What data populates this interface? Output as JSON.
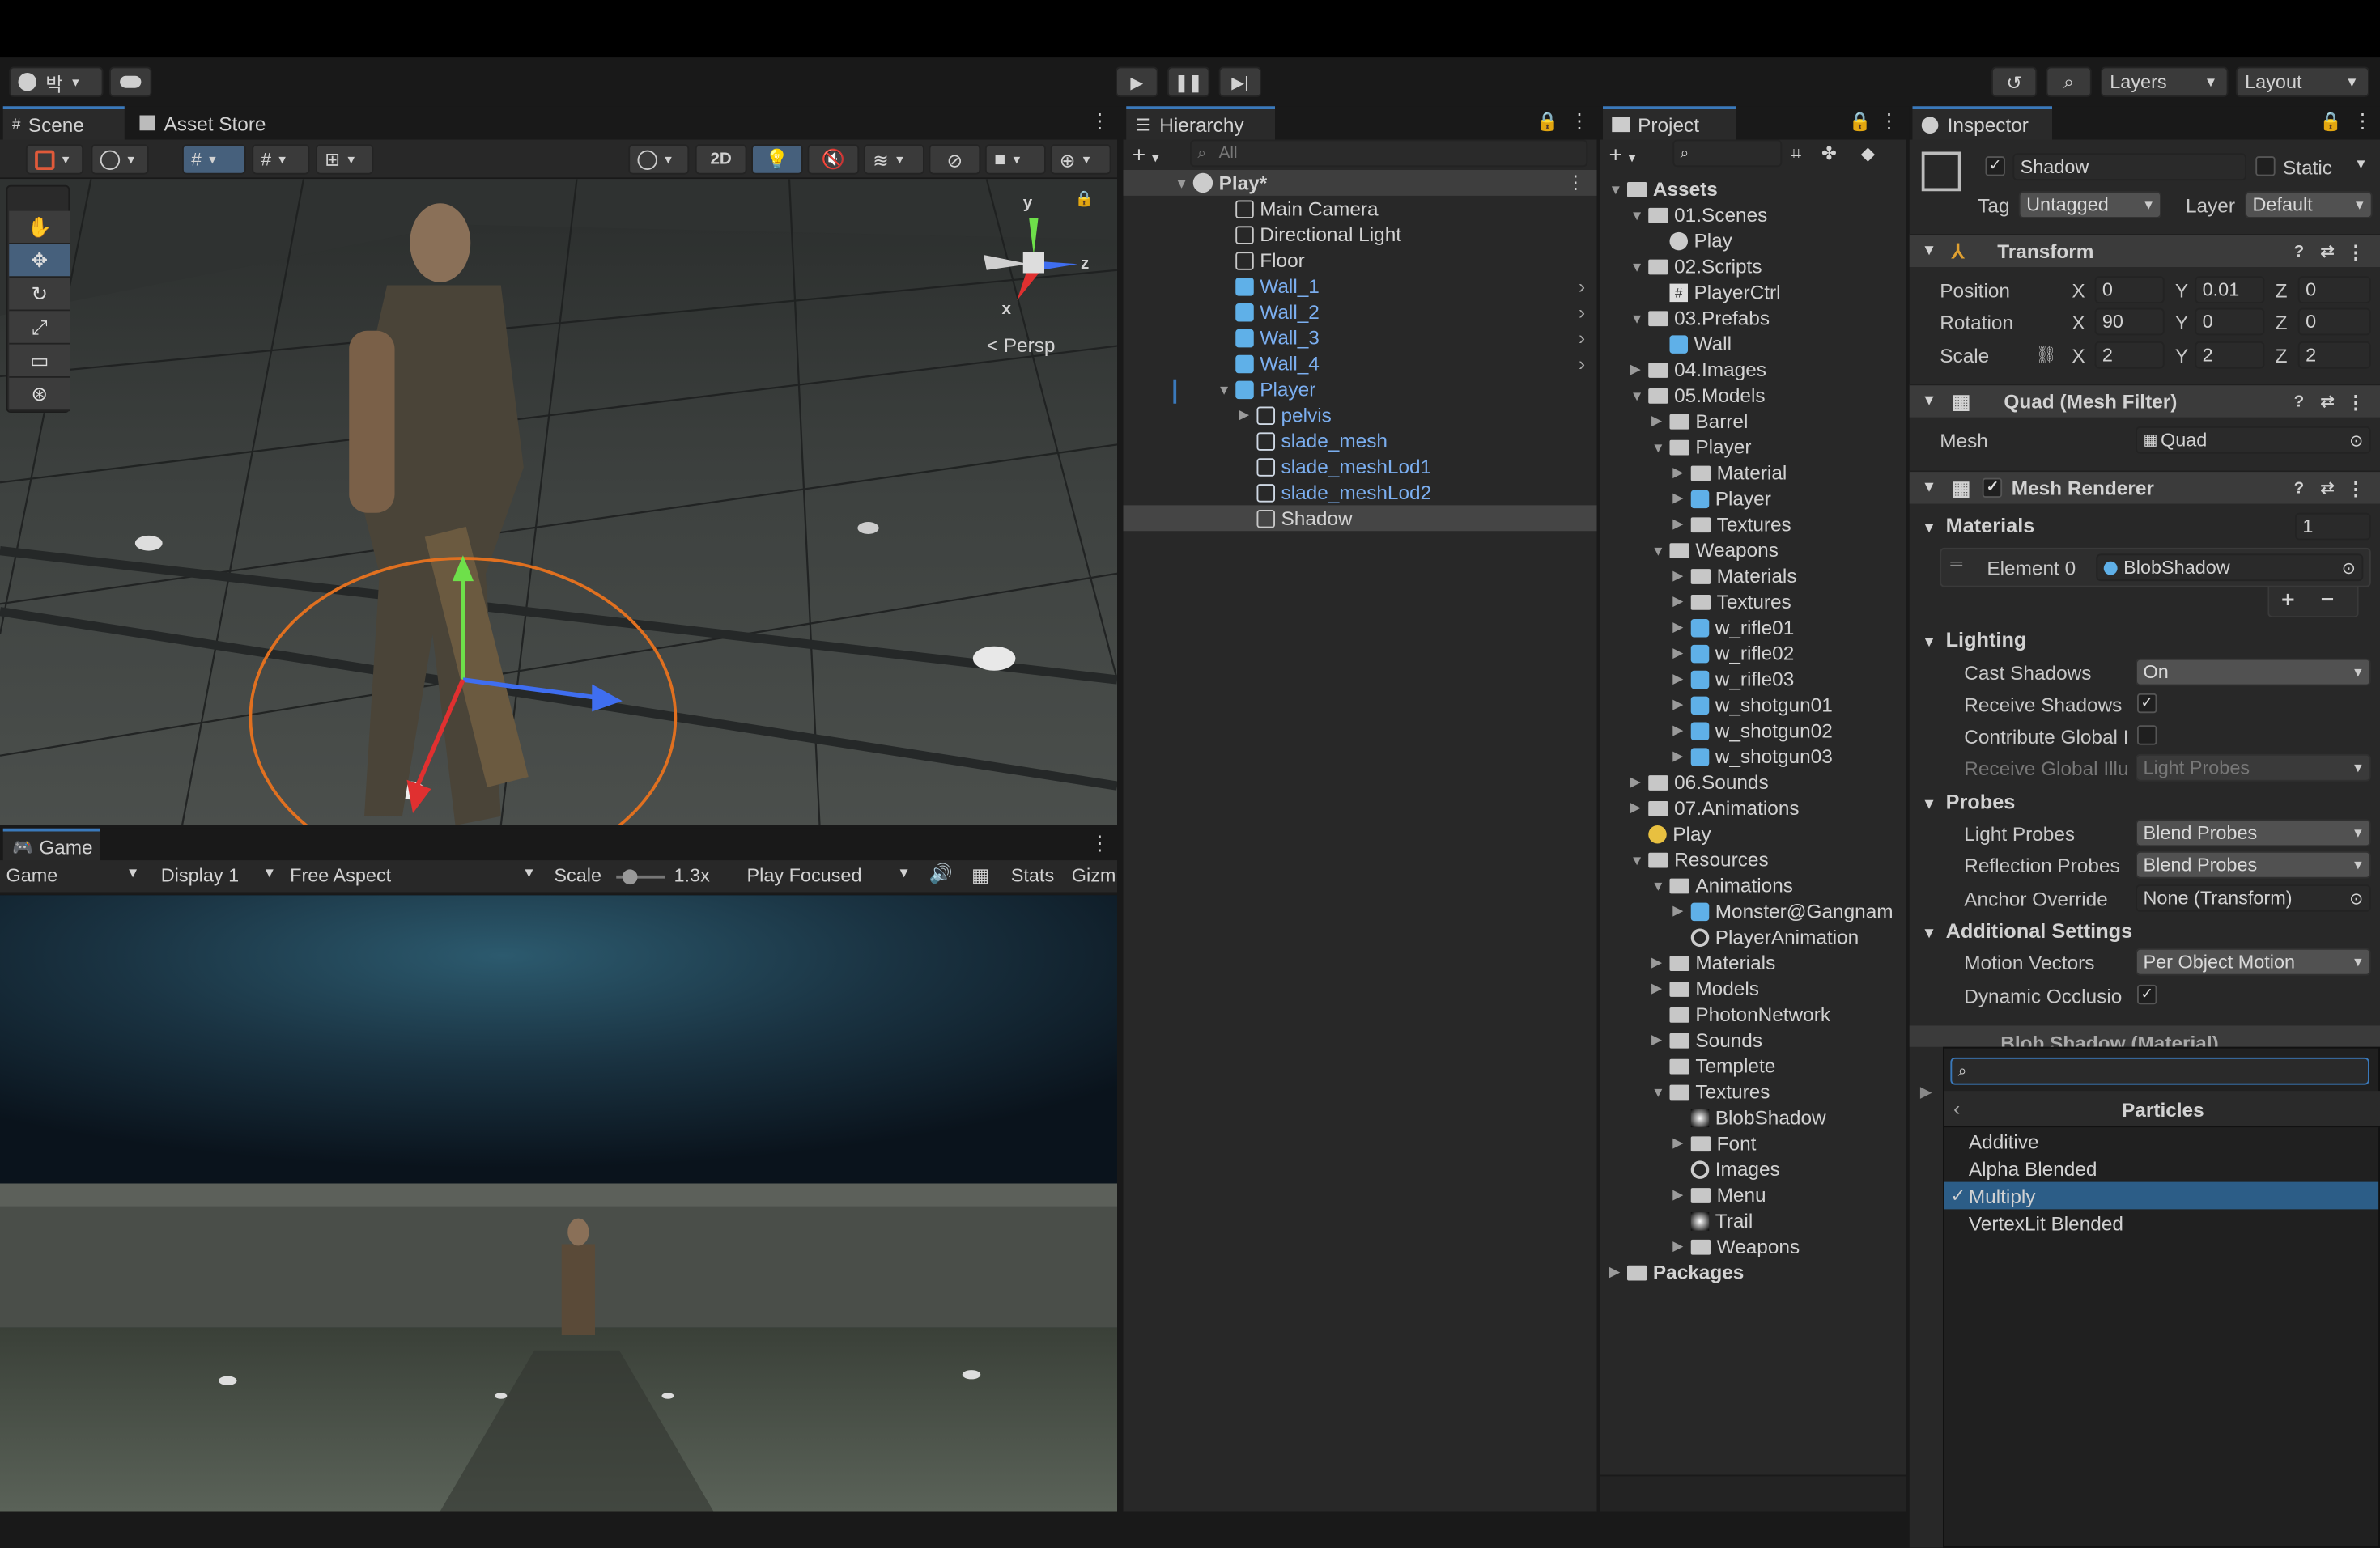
{
  "toolbar": {
    "account_label": "박",
    "layers_label": "Layers",
    "layout_label": "Layout"
  },
  "scene_panel": {
    "tab_scene": "Scene",
    "tab_asset_store": "Asset Store",
    "btn_2d": "2D",
    "persp_label": "< Persp",
    "gizmo_axes": {
      "y": "y",
      "z": "z",
      "x": "x"
    }
  },
  "game_panel": {
    "tab": "Game",
    "mode": "Game",
    "display": "Display 1",
    "aspect": "Free Aspect",
    "scale_label": "Scale",
    "scale_value": "1.3x",
    "play_focus": "Play Focused",
    "stats": "Stats",
    "gizmos": "Gizm"
  },
  "hierarchy": {
    "tab": "Hierarchy",
    "search_placeholder": "All",
    "root": "Play*",
    "items": [
      {
        "label": "Main Camera",
        "blue": false,
        "depth": 1
      },
      {
        "label": "Directional Light",
        "blue": false,
        "depth": 1
      },
      {
        "label": "Floor",
        "blue": false,
        "depth": 1
      },
      {
        "label": "Wall_1",
        "blue": true,
        "depth": 1
      },
      {
        "label": "Wall_2",
        "blue": true,
        "depth": 1
      },
      {
        "label": "Wall_3",
        "blue": true,
        "depth": 1
      },
      {
        "label": "Wall_4",
        "blue": true,
        "depth": 1
      },
      {
        "label": "Player",
        "blue": true,
        "depth": 1
      },
      {
        "label": "pelvis",
        "blue": true,
        "depth": 2
      },
      {
        "label": "slade_mesh",
        "blue": true,
        "depth": 2
      },
      {
        "label": "slade_meshLod1",
        "blue": true,
        "depth": 2
      },
      {
        "label": "slade_meshLod2",
        "blue": true,
        "depth": 2
      },
      {
        "label": "Shadow",
        "blue": false,
        "depth": 2
      }
    ]
  },
  "project": {
    "tab": "Project",
    "items": [
      {
        "label": "Assets",
        "depth": 0,
        "bold": true
      },
      {
        "label": "01.Scenes",
        "depth": 1
      },
      {
        "label": "Play",
        "depth": 2
      },
      {
        "label": "02.Scripts",
        "depth": 1
      },
      {
        "label": "PlayerCtrl",
        "depth": 2
      },
      {
        "label": "03.Prefabs",
        "depth": 1
      },
      {
        "label": "Wall",
        "depth": 2
      },
      {
        "label": "04.Images",
        "depth": 1
      },
      {
        "label": "05.Models",
        "depth": 1
      },
      {
        "label": "Barrel",
        "depth": 2
      },
      {
        "label": "Player",
        "depth": 2
      },
      {
        "label": "Material",
        "depth": 3
      },
      {
        "label": "Player",
        "depth": 3
      },
      {
        "label": "Textures",
        "depth": 3
      },
      {
        "label": "Weapons",
        "depth": 2
      },
      {
        "label": "Materials",
        "depth": 3
      },
      {
        "label": "Textures",
        "depth": 3
      },
      {
        "label": "w_rifle01",
        "depth": 3
      },
      {
        "label": "w_rifle02",
        "depth": 3
      },
      {
        "label": "w_rifle03",
        "depth": 3
      },
      {
        "label": "w_shotgun01",
        "depth": 3
      },
      {
        "label": "w_shotgun02",
        "depth": 3
      },
      {
        "label": "w_shotgun03",
        "depth": 3
      },
      {
        "label": "06.Sounds",
        "depth": 1
      },
      {
        "label": "07.Animations",
        "depth": 1
      },
      {
        "label": "Play",
        "depth": 1
      },
      {
        "label": "Resources",
        "depth": 1
      },
      {
        "label": "Animations",
        "depth": 2
      },
      {
        "label": "Monster@Gangnam",
        "depth": 3
      },
      {
        "label": "PlayerAnimation",
        "depth": 3
      },
      {
        "label": "Materials",
        "depth": 2
      },
      {
        "label": "Models",
        "depth": 2
      },
      {
        "label": "PhotonNetwork",
        "depth": 2
      },
      {
        "label": "Sounds",
        "depth": 2
      },
      {
        "label": "Templete",
        "depth": 2
      },
      {
        "label": "Textures",
        "depth": 2
      },
      {
        "label": "BlobShadow",
        "depth": 3
      },
      {
        "label": "Font",
        "depth": 3
      },
      {
        "label": "Images",
        "depth": 3
      },
      {
        "label": "Menu",
        "depth": 3
      },
      {
        "label": "Trail",
        "depth": 3
      },
      {
        "label": "Weapons",
        "depth": 3
      },
      {
        "label": "Packages",
        "depth": 0,
        "bold": true
      }
    ]
  },
  "inspector": {
    "tab": "Inspector",
    "object_name": "Shadow",
    "static_label": "Static",
    "tag_label": "Tag",
    "tag_value": "Untagged",
    "layer_label": "Layer",
    "layer_value": "Default",
    "transform": {
      "title": "Transform",
      "position_label": "Position",
      "rotation_label": "Rotation",
      "scale_label": "Scale",
      "position": {
        "x": "0",
        "y": "0.01",
        "z": "0"
      },
      "rotation": {
        "x": "90",
        "y": "0",
        "z": "0"
      },
      "scale": {
        "x": "2",
        "y": "2",
        "z": "2"
      },
      "axis_x": "X",
      "axis_y": "Y",
      "axis_z": "Z"
    },
    "mesh_filter": {
      "title": "Quad (Mesh Filter)",
      "mesh_label": "Mesh",
      "mesh_value": "Quad"
    },
    "mesh_renderer": {
      "title": "Mesh Renderer",
      "materials_label": "Materials",
      "materials_count": "1",
      "element0_label": "Element 0",
      "element0_value": "BlobShadow",
      "lighting_label": "Lighting",
      "cast_shadows_label": "Cast Shadows",
      "cast_shadows_value": "On",
      "receive_shadows_label": "Receive Shadows",
      "contribute_gi_label": "Contribute Global I",
      "receive_gi_label": "Receive Global Illu",
      "receive_gi_value": "Light Probes",
      "probes_label": "Probes",
      "light_probes_label": "Light Probes",
      "light_probes_value": "Blend Probes",
      "reflection_probes_label": "Reflection Probes",
      "reflection_probes_value": "Blend Probes",
      "anchor_override_label": "Anchor Override",
      "anchor_override_value": "None (Transform)",
      "additional_label": "Additional Settings",
      "motion_vectors_label": "Motion Vectors",
      "motion_vectors_value": "Per Object Motion",
      "dynamic_occlusion_label": "Dynamic Occlusio"
    },
    "material_peek": "Blob Shadow (Material)"
  },
  "shader_popup": {
    "search_value": "",
    "category": "Particles",
    "options": [
      "Additive",
      "Alpha Blended",
      "Multiply",
      "VertexLit Blended"
    ],
    "selected": "Multiply",
    "check": "✓"
  }
}
